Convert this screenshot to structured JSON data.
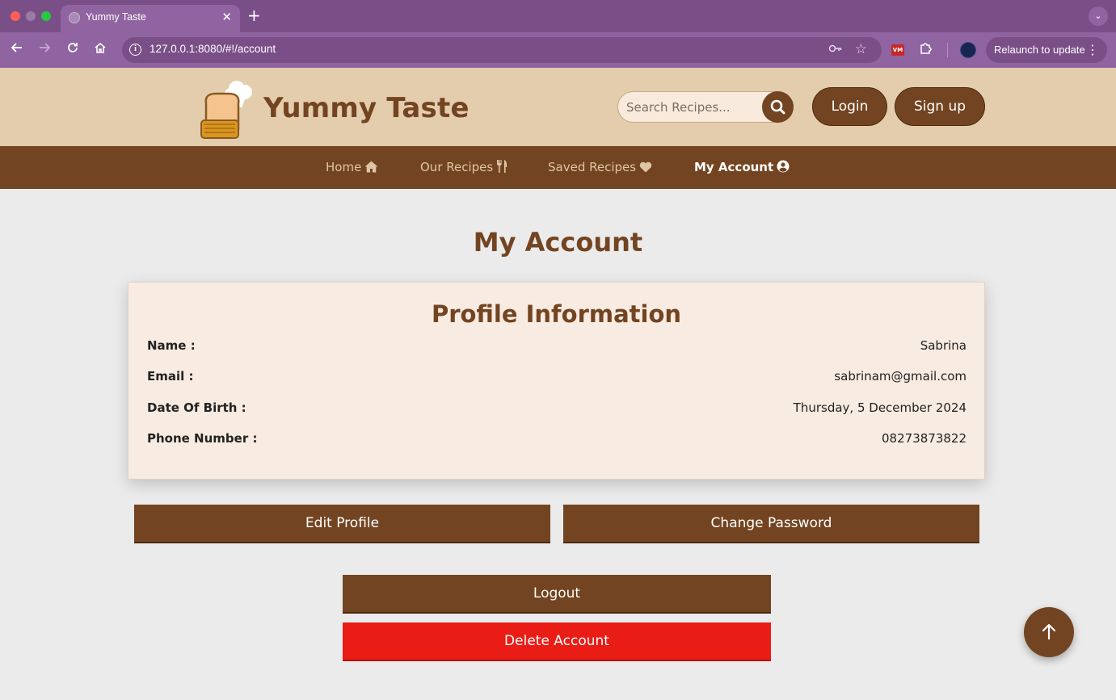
{
  "browser": {
    "tab_title": "Yummy Taste",
    "url": "127.0.0.1:8080/#!/account",
    "relaunch_label": "Relaunch to update",
    "extension_label": "VM"
  },
  "header": {
    "brand": "Yummy Taste",
    "search_placeholder": "Search Recipes...",
    "login_label": "Login",
    "signup_label": "Sign up"
  },
  "nav": {
    "items": [
      {
        "label": "Home",
        "icon": "home-icon",
        "active": false
      },
      {
        "label": "Our Recipes",
        "icon": "utensils-icon",
        "active": false
      },
      {
        "label": "Saved Recipes",
        "icon": "heart-icon",
        "active": false
      },
      {
        "label": "My Account",
        "icon": "user-circle-icon",
        "active": true
      }
    ]
  },
  "main": {
    "page_title": "My Account",
    "profile": {
      "title": "Profile Information",
      "fields": [
        {
          "label": "Name :",
          "value": "Sabrina"
        },
        {
          "label": "Email :",
          "value": "sabrinam@gmail.com"
        },
        {
          "label": "Date Of Birth :",
          "value": "Thursday, 5 December 2024"
        },
        {
          "label": "Phone Number :",
          "value": "08273873822"
        }
      ]
    },
    "buttons": {
      "edit_profile": "Edit Profile",
      "change_password": "Change Password",
      "logout": "Logout",
      "delete_account": "Delete Account"
    }
  },
  "colors": {
    "brand_brown": "#734421",
    "header_tan": "#e3cdac",
    "card_bg": "#f8ebe1",
    "danger_red": "#ea1c16",
    "browser_purple": "#8f64a0"
  }
}
